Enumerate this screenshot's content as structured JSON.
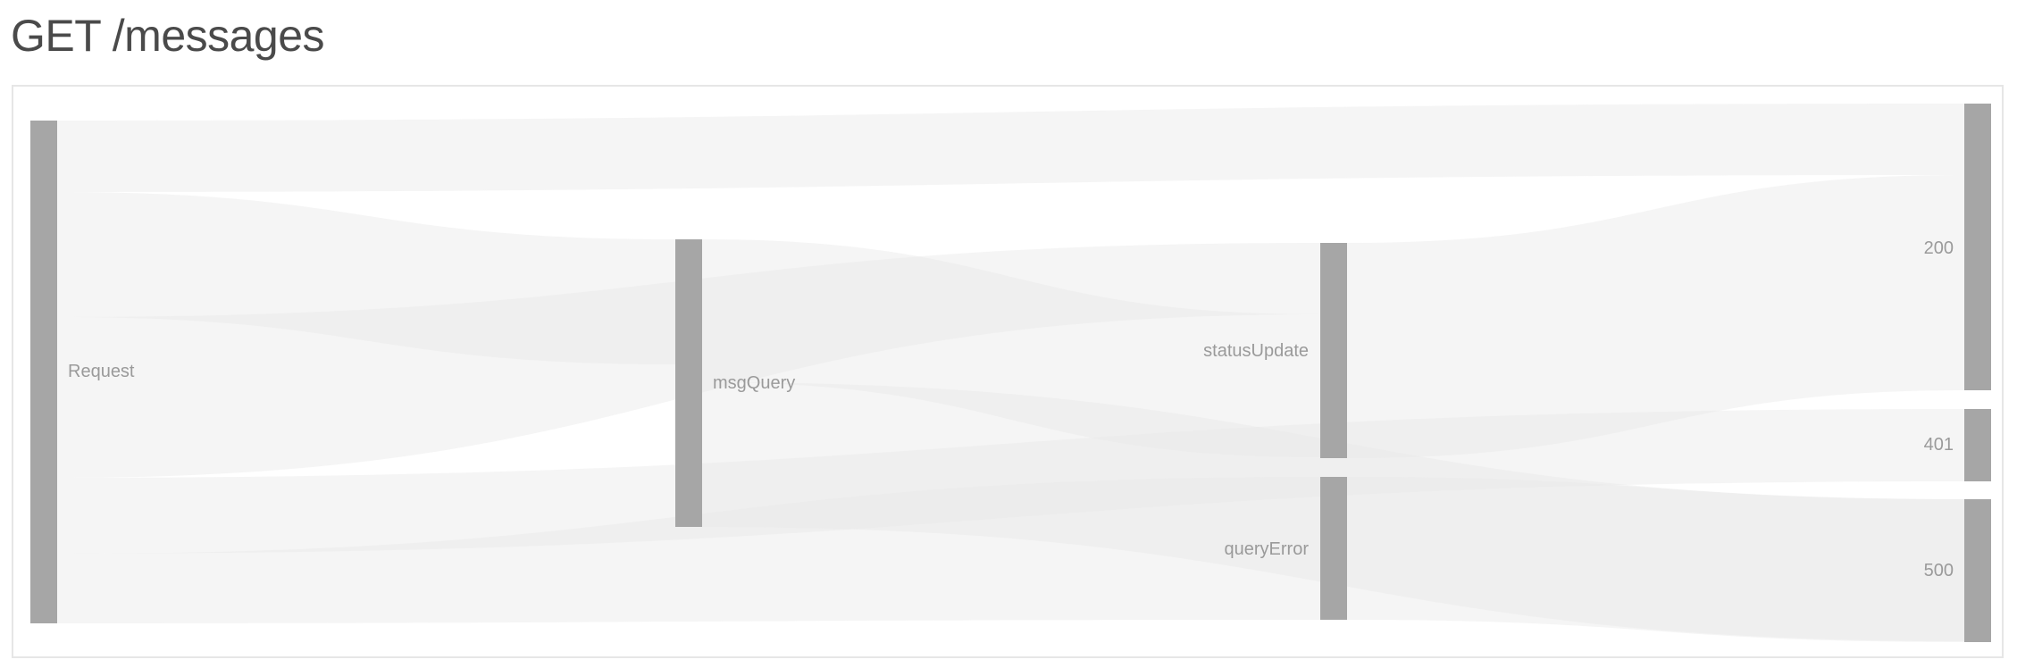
{
  "page": {
    "title": "GET /messages"
  },
  "diagram": {
    "type": "sankey",
    "colors": {
      "node": "#a6a6a6",
      "link": "#e8e8e8",
      "label": "#9a9a9a",
      "border": "#e6e6e6"
    },
    "nodes": [
      {
        "id": "request",
        "label": "Request"
      },
      {
        "id": "msgQuery",
        "label": "msgQuery"
      },
      {
        "id": "statusUpdate",
        "label": "statusUpdate"
      },
      {
        "id": "queryError",
        "label": "queryError"
      },
      {
        "id": "s200",
        "label": "200"
      },
      {
        "id": "s401",
        "label": "401"
      },
      {
        "id": "s500",
        "label": "500"
      }
    ],
    "links": [
      {
        "source": "request",
        "target": "s200"
      },
      {
        "source": "request",
        "target": "msgQuery"
      },
      {
        "source": "request",
        "target": "statusUpdate"
      },
      {
        "source": "request",
        "target": "s401"
      },
      {
        "source": "request",
        "target": "queryError"
      },
      {
        "source": "msgQuery",
        "target": "statusUpdate"
      },
      {
        "source": "msgQuery",
        "target": "s500"
      },
      {
        "source": "statusUpdate",
        "target": "s200"
      },
      {
        "source": "statusUpdate",
        "target": "s401"
      },
      {
        "source": "queryError",
        "target": "s500"
      }
    ]
  }
}
